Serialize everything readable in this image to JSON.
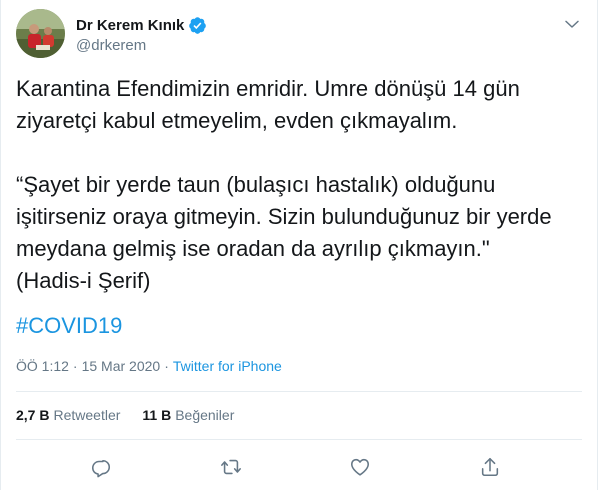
{
  "author": {
    "display_name": "Dr Kerem Kınık",
    "handle": "@drkerem",
    "verified": true
  },
  "tweet": {
    "lines_1": [
      "Karantina Efendimizin emridir. Umre dönüşü 14 gün",
      "ziyaretçi kabul etmeyelim, evden çıkmayalım."
    ],
    "lines_2": [
      "“Şayet bir yerde taun (bulaşıcı hastalık) olduğunu",
      "işitirseniz oraya gitmeyin. Sizin bulunduğunuz bir yerde",
      "meydana gelmiş ise oradan da ayrılıp çıkmayın.\"",
      "(Hadis-i Şerif)"
    ],
    "hashtag": "#COVID19"
  },
  "meta": {
    "time": "ÖÖ 1:12",
    "separator": "·",
    "date": "15 Mar 2020",
    "source": "Twitter for iPhone"
  },
  "stats": {
    "retweets_count": "2,7 B",
    "retweets_label": "Retweetler",
    "likes_count": "11 B",
    "likes_label": "Beğeniler"
  },
  "actions": [
    "reply-icon",
    "retweet-icon",
    "like-icon",
    "share-icon"
  ],
  "colors": {
    "link": "#1b95e0",
    "secondary_text": "#657786",
    "divider": "#e6ecf0",
    "verified": "#1da1f2"
  }
}
